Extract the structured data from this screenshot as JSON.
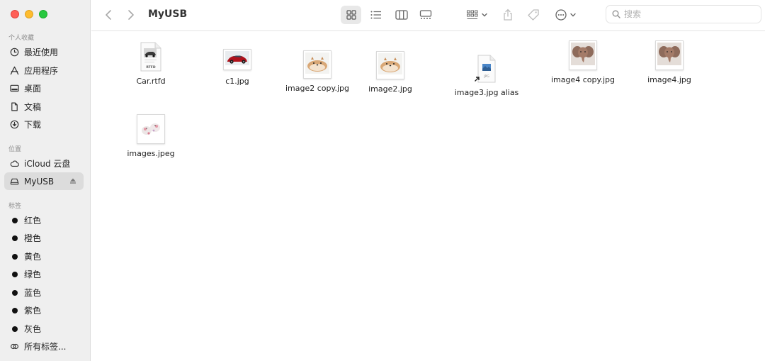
{
  "window": {
    "title": "MyUSB"
  },
  "search": {
    "placeholder": "搜索"
  },
  "sidebar": {
    "favorites_title": "个人收藏",
    "favorites": [
      {
        "label": "最近使用",
        "icon": "clock-icon"
      },
      {
        "label": "应用程序",
        "icon": "apps-icon"
      },
      {
        "label": "桌面",
        "icon": "desktop-icon"
      },
      {
        "label": "文稿",
        "icon": "document-icon"
      },
      {
        "label": "下载",
        "icon": "download-icon"
      }
    ],
    "locations_title": "位置",
    "locations": [
      {
        "label": "iCloud 云盘",
        "icon": "cloud-icon"
      },
      {
        "label": "MyUSB",
        "icon": "drive-icon",
        "selected": true
      }
    ],
    "tags_title": "标签",
    "tags": [
      {
        "label": "红色"
      },
      {
        "label": "橙色"
      },
      {
        "label": "黄色"
      },
      {
        "label": "绿色"
      },
      {
        "label": "蓝色"
      },
      {
        "label": "紫色"
      },
      {
        "label": "灰色"
      }
    ],
    "all_tags": "所有标签..."
  },
  "files": [
    {
      "name": "Car.rtfd",
      "kind": "rtfd-document",
      "badge": "RTFD"
    },
    {
      "name": "c1.jpg",
      "kind": "car-image"
    },
    {
      "name": "image2 copy.jpg",
      "kind": "dog-image"
    },
    {
      "name": "image2.jpg",
      "kind": "dog-image"
    },
    {
      "name": "image3.jpg alias",
      "kind": "alias-document",
      "badge": "JPG"
    },
    {
      "name": "image4 copy.jpg",
      "kind": "elephant-image"
    },
    {
      "name": "image4.jpg",
      "kind": "elephant-image"
    },
    {
      "name": "images.jpeg",
      "kind": "toys-image"
    }
  ],
  "colors": {
    "close": "#ff5f57",
    "minimize": "#febc2e",
    "maximize": "#28c840",
    "sidebar_bg": "#efefef",
    "selection": "#dcdcdc"
  }
}
